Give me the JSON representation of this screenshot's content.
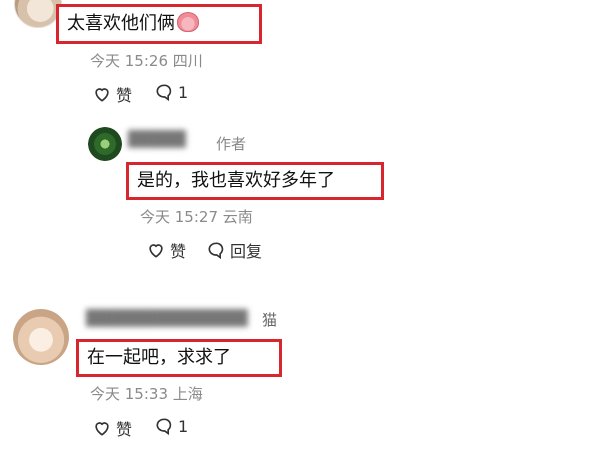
{
  "comments": [
    {
      "text": "太喜欢他们俩",
      "emoji": "pig-face-emoji",
      "time": "今天 15:26",
      "location": "四川",
      "like_label": "赞",
      "comment_count": "1"
    }
  ],
  "reply": {
    "author_suffix": "作者",
    "text": "是的，我也喜欢好多年了",
    "time": "今天 15:27",
    "location": "云南",
    "like_label": "赞",
    "reply_label": "回复"
  },
  "comment3": {
    "name_suffix": "猫",
    "text": "在一起吧，求求了",
    "time": "今天 15:33",
    "location": "上海",
    "like_label": "赞",
    "comment_count": "1"
  },
  "colors": {
    "highlight_border": "#d7262e",
    "meta_text": "#8a8a8a"
  }
}
